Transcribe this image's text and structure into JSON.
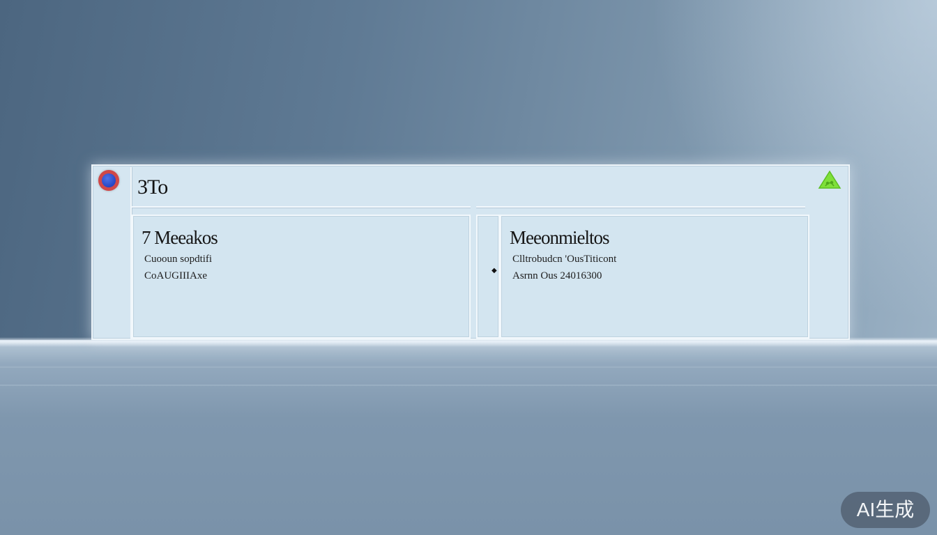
{
  "window": {
    "title": "3To"
  },
  "panels": [
    {
      "title": "7 Meeakos",
      "lines": [
        "Cuooun sopdtifi",
        "CoAUGIIIAxe"
      ]
    },
    {
      "title": "Meeonmieltos",
      "lines": [
        "Clltrobudcn 'OusTiticont",
        "Asrnn Ous 24016300"
      ]
    }
  ],
  "icons": {
    "app": "app-logo-icon",
    "status": "warning-icon",
    "bullet": "bullet-icon"
  },
  "colors": {
    "app_icon_outer": "#d04848",
    "app_icon_inner": "#2646c4",
    "warning": "#7fe03a"
  },
  "badge": {
    "label": "AI生成"
  }
}
